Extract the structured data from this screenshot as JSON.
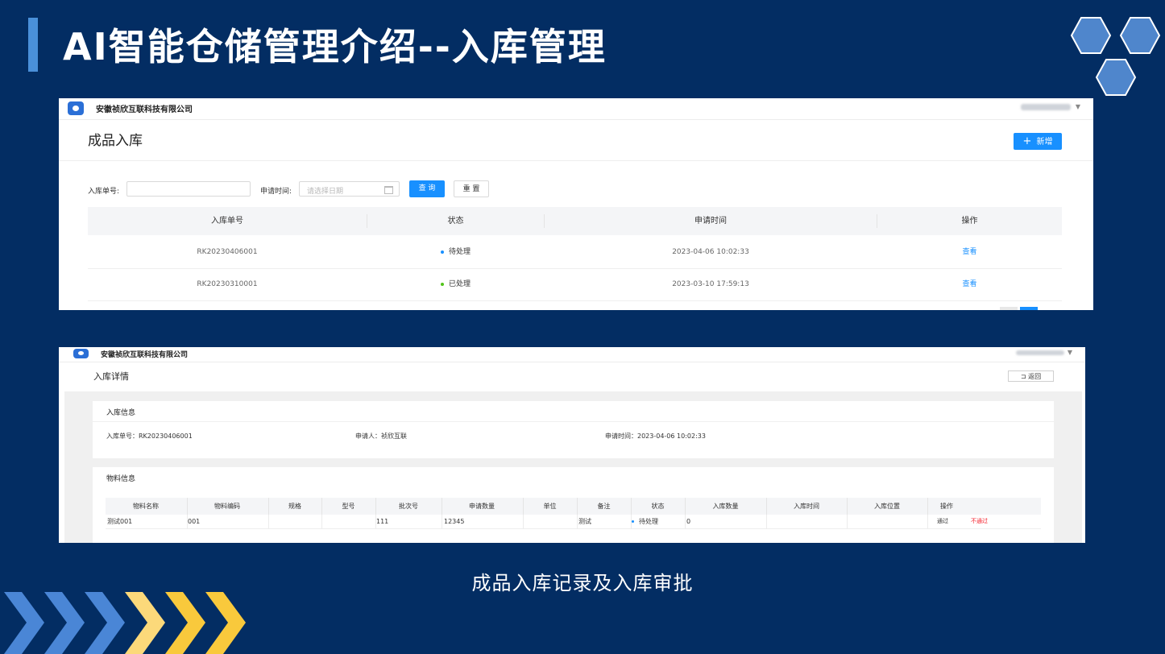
{
  "slide": {
    "title": "AI智能仓储管理介绍--入库管理",
    "caption": "成品入库记录及入库审批",
    "colors": {
      "background": "#032d63",
      "accent": "#4a90d9",
      "hex": "#4f86cc",
      "chevron_blue": "#4a86d6",
      "chevron_yellow": "#f9c93c"
    }
  },
  "list_screen": {
    "company": "安徽祯欣互联科技有限公司",
    "page_title": "成品入库",
    "add_button": "新增",
    "add_icon": "plus-icon",
    "filters": {
      "order_no_label": "入库单号:",
      "order_no_value": "",
      "apply_time_label": "申请时间:",
      "apply_time_placeholder": "请选择日期",
      "query_button": "查 询",
      "reset_button": "重 置"
    },
    "table": {
      "headers": [
        "入库单号",
        "状态",
        "申请时间",
        "操作"
      ],
      "rows": [
        {
          "order_no": "RK20230406001",
          "status": "待处理",
          "status_color": "#1890ff",
          "apply_time": "2023-04-06 10:02:33",
          "action": "查看"
        },
        {
          "order_no": "RK20230310001",
          "status": "已处理",
          "status_color": "#52c41a",
          "apply_time": "2023-03-10 17:59:13",
          "action": "查看"
        }
      ]
    }
  },
  "detail_screen": {
    "company": "安徽祯欣互联科技有限公司",
    "page_title": "入库详情",
    "back_button": "返回",
    "back_icon": "return-icon",
    "info_card": {
      "title": "入库信息",
      "order_no": "入库单号：RK20230406001",
      "applicant": "申请人：祯欣互联",
      "apply_time": "申请时间：2023-04-06 10:02:33"
    },
    "material_card": {
      "title": "物料信息",
      "headers": [
        "物料名称",
        "物料编码",
        "规格",
        "型号",
        "批次号",
        "申请数量",
        "单位",
        "备注",
        "状态",
        "入库数量",
        "入库时间",
        "入库位置",
        "操作"
      ],
      "row": {
        "name": "测试001",
        "code": "001",
        "spec": "",
        "model": "",
        "batch": "111",
        "apply_qty": "12345",
        "unit": "",
        "remark": "测试",
        "status": "待处理",
        "in_qty": "0",
        "in_time": "",
        "in_location": "",
        "approve": "通过",
        "reject": "不通过"
      }
    }
  }
}
